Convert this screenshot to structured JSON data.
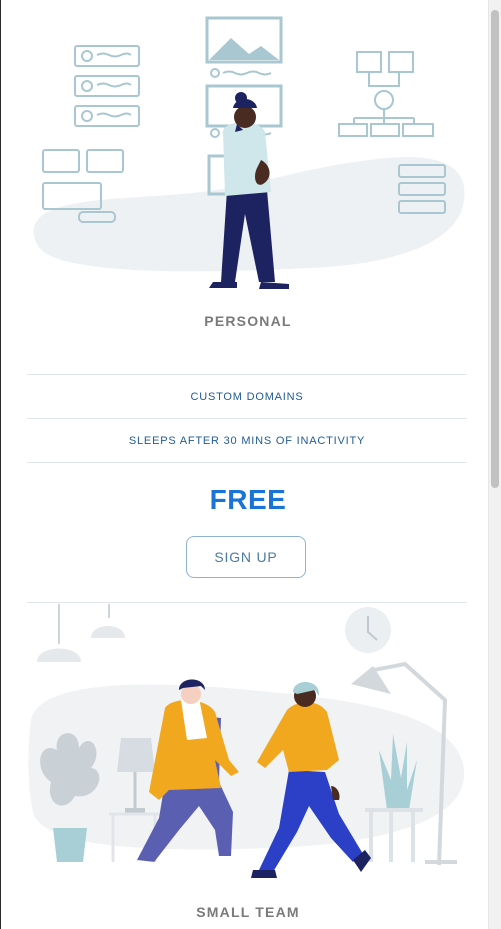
{
  "plans": [
    {
      "name": "PERSONAL",
      "features": [
        "CUSTOM DOMAINS",
        "SLEEPS AFTER 30 MINS OF INACTIVITY"
      ],
      "price": "FREE",
      "cta": "SIGN UP",
      "illustration": "person-walking-with-boards-illustration"
    },
    {
      "name": "SMALL TEAM",
      "illustration": "two-people-office-illustration"
    }
  ],
  "colors": {
    "price": "#1a73d6",
    "feature_text": "#1f5b96",
    "plan_name": "#7a7a7a",
    "button_border": "#8fb3cf"
  }
}
